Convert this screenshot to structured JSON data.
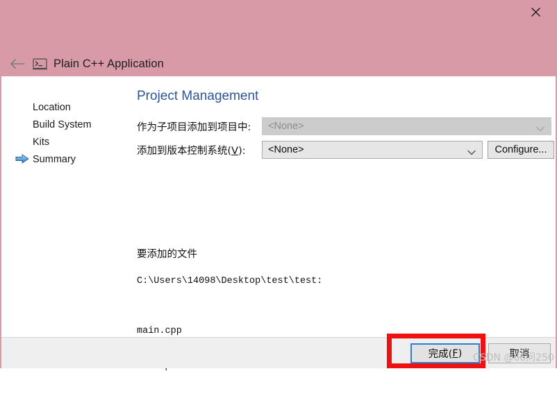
{
  "window": {
    "header_title": "Plain C++ Application",
    "close_label": "✕",
    "back_label": "←",
    "console_icon": "console-icon",
    "accent_pink": "#d99aa8"
  },
  "sidebar": {
    "items": [
      {
        "label": "Location",
        "current": false
      },
      {
        "label": "Build System",
        "current": false
      },
      {
        "label": "Kits",
        "current": false
      },
      {
        "label": "Summary",
        "current": true
      }
    ]
  },
  "main": {
    "page_title": "Project Management",
    "title_color": "#2a5699",
    "fields": [
      {
        "label_prefix": "作为子项目添加到项目中:",
        "label_accel": "",
        "label_suffix": "",
        "value": "<None>",
        "enabled": false
      },
      {
        "label_prefix": "添加到版本控制系统(",
        "label_accel": "V",
        "label_suffix": "):",
        "value": "<None>",
        "enabled": true
      }
    ],
    "configure_label": "Configure...",
    "files": {
      "heading": "要添加的文件",
      "path": "C:\\Users\\14098\\Desktop\\test\\test:",
      "entries": [
        "main.cpp",
        "test.pro"
      ]
    }
  },
  "footer": {
    "finish_prefix": "完成(",
    "finish_accel": "F",
    "finish_suffix": ")",
    "cancel_label": "取消",
    "annotation_color": "#ee1111"
  },
  "watermark": {
    "text": "CSDN @66问250"
  }
}
